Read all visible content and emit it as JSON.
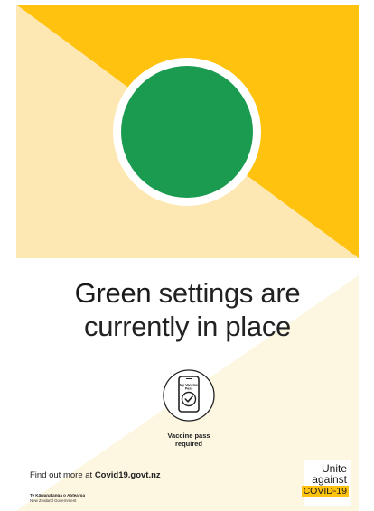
{
  "poster": {
    "headline_strong": "Green",
    "headline_rest_1": "settings are",
    "headline_line_2": "currently in place",
    "pass_icon": {
      "name": "vaccine-pass-phone-icon",
      "text_line_1": "My Vaccine",
      "text_line_2": "Pass"
    },
    "pass_label_line_1": "Vaccine pass",
    "pass_label_line_2": "required",
    "find_out_text": "Find out more at",
    "find_out_url": "Covid19.govt.nz",
    "gov_maori": "Te Kāwanatanga o Aotearoa",
    "gov_english": "New Zealand Government",
    "logo_line_1": "Unite",
    "logo_line_2": "against",
    "logo_line_3": "COVID-19"
  },
  "colors": {
    "yellow": "#ffc20e",
    "pale_yellow": "#fde8b3",
    "cream": "#fdf6e0",
    "traffic_green": "#1a9b4f",
    "text_dark": "#222222"
  }
}
